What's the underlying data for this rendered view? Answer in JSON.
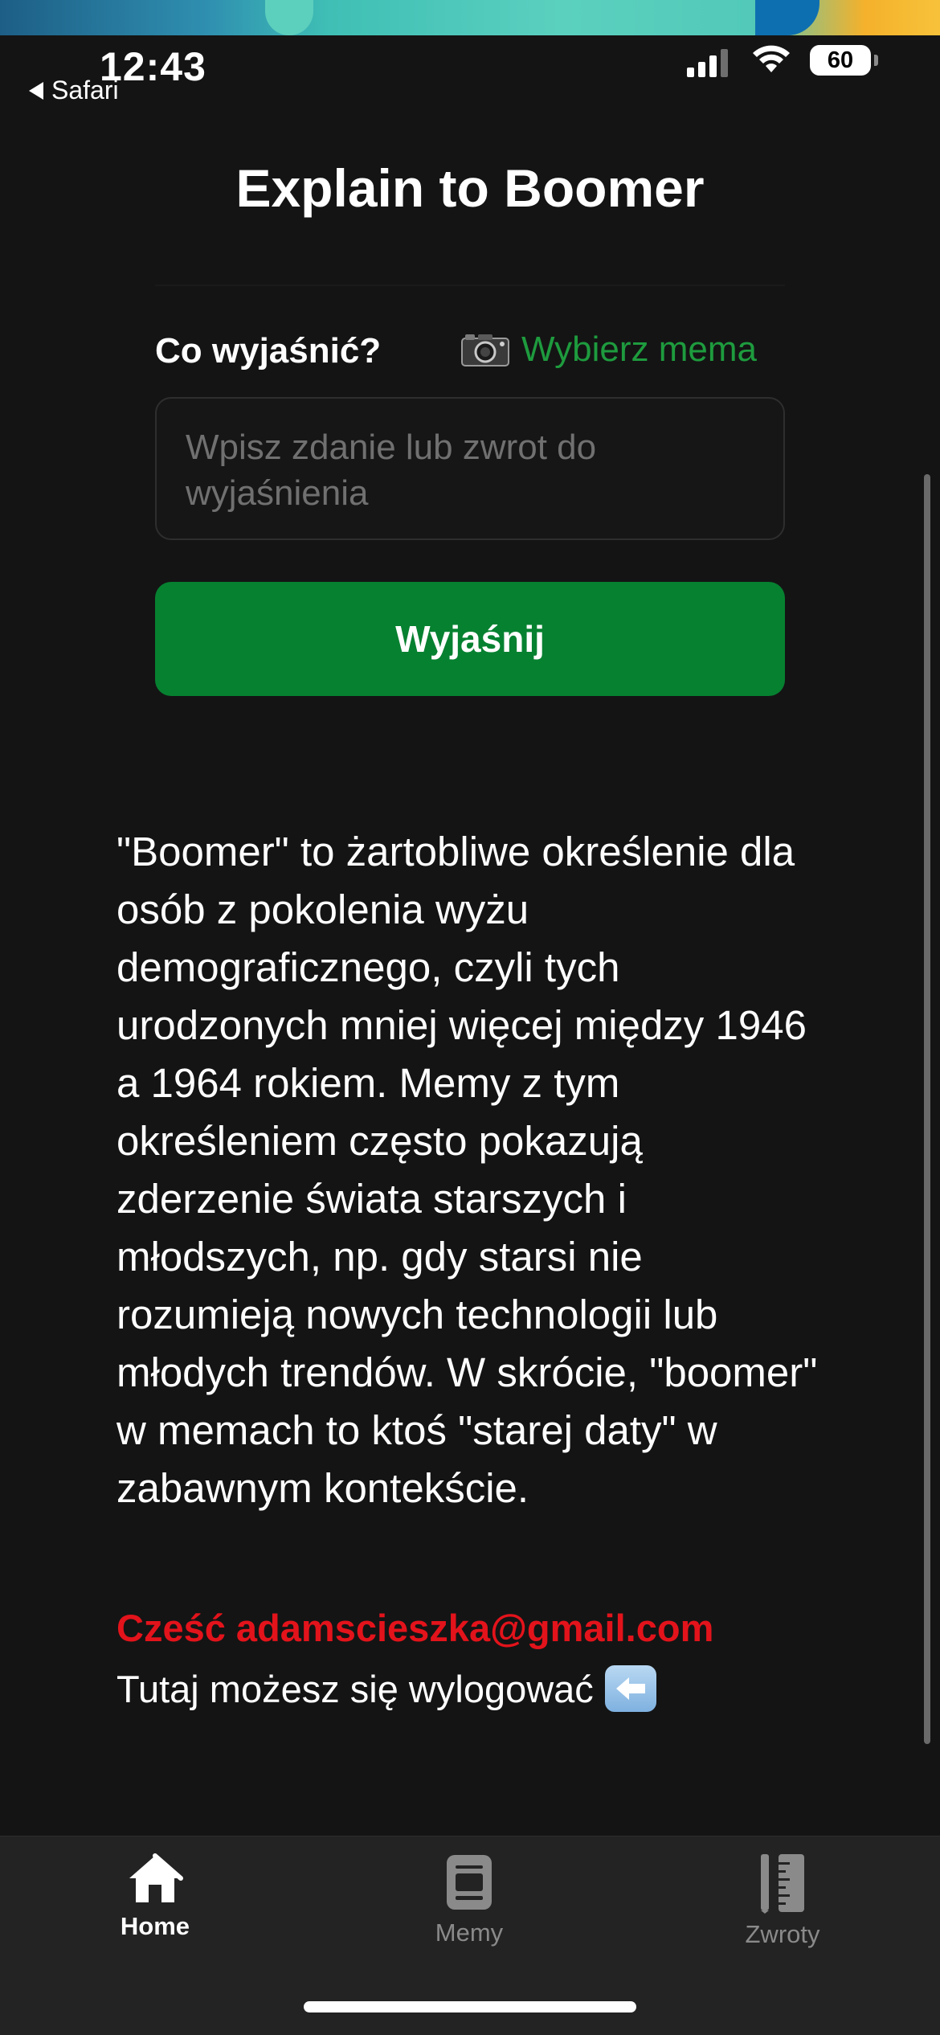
{
  "status_bar": {
    "time": "12:43",
    "back_app": "Safari",
    "battery": "60"
  },
  "header": {
    "title": "Explain to Boomer"
  },
  "form": {
    "label": "Co wyjaśnić?",
    "pick_meme_icon": "camera-icon",
    "pick_meme_label": "Wybierz mema",
    "input_placeholder": "Wpisz zdanie lub zwrot do wyjaśnienia",
    "input_value": "",
    "submit_label": "Wyjaśnij"
  },
  "result": {
    "text": "\"Boomer\" to żartobliwe określenie dla osób z pokolenia wyżu demograficznego, czyli tych urodzonych mniej więcej między 1946 a 1964 rokiem. Memy z tym określeniem często pokazują zderzenie świata starszych i młodszych, np. gdy starsi nie rozumieją nowych technologii lub młodych trendów. W skrócie, \"boomer\" w memach to ktoś \"starej daty\" w zabawnym kontekście."
  },
  "account": {
    "greeting": "Cześć adamscieszka@gmail.com",
    "logout_text": "Tutaj możesz się wylogować",
    "logout_icon": "left-arrow-icon"
  },
  "tab_bar": {
    "tabs": [
      {
        "label": "Home",
        "icon": "home-icon",
        "active": true
      },
      {
        "label": "Memy",
        "icon": "meme-icon",
        "active": false
      },
      {
        "label": "Zwroty",
        "icon": "ruler-pencil-icon",
        "active": false
      }
    ]
  },
  "colors": {
    "background": "#141414",
    "accent_green": "#068130",
    "link_green": "#1e9b3e",
    "greeting_red": "#e3131b",
    "tab_bar": "#232323"
  }
}
